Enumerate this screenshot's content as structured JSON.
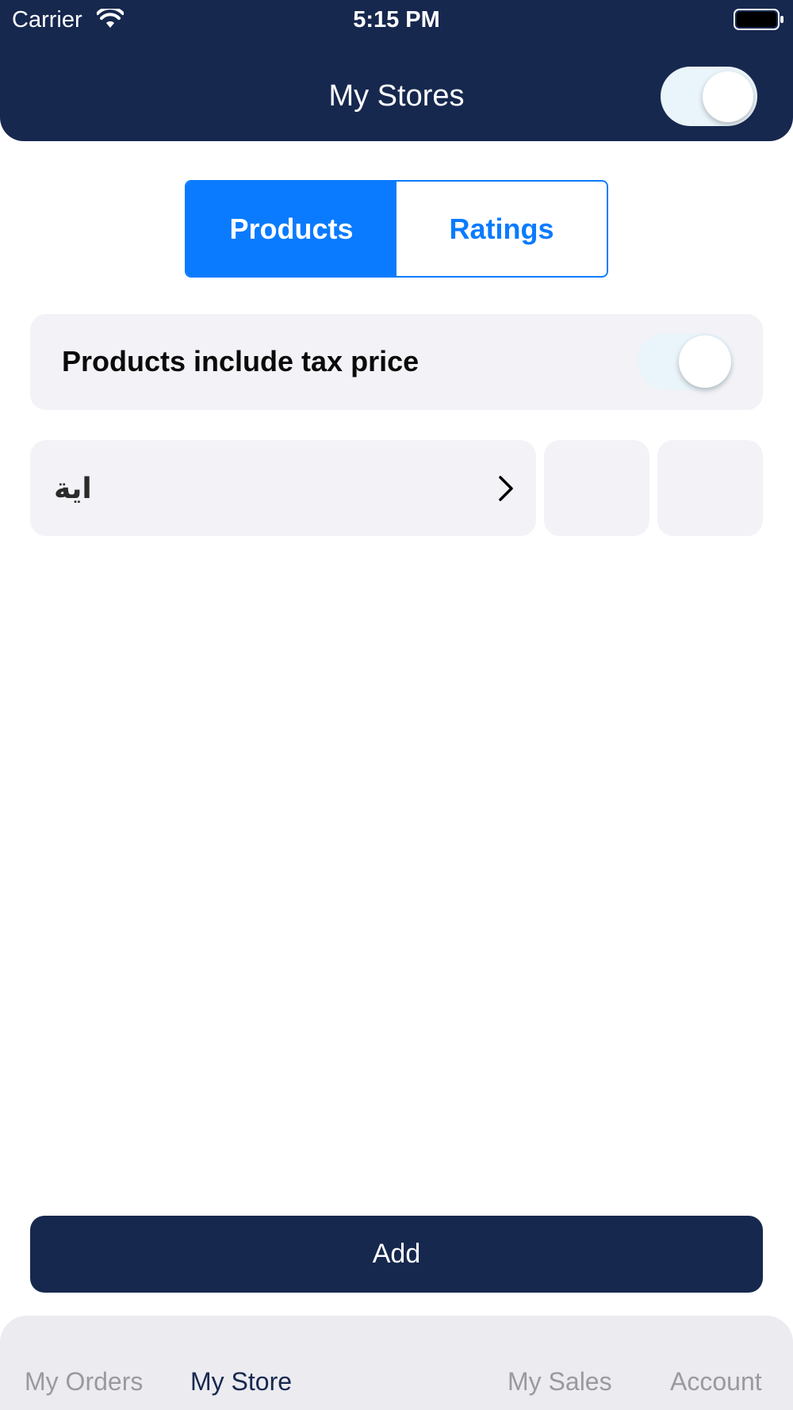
{
  "status_bar": {
    "carrier": "Carrier",
    "time": "5:15 PM",
    "icons": [
      "wifi-icon",
      "battery-icon"
    ]
  },
  "header": {
    "title": "My Stores",
    "store_toggle_on": true,
    "background_color": "#17284f"
  },
  "segmented_control": {
    "tabs": [
      {
        "label": "Products",
        "selected": true
      },
      {
        "label": "Ratings",
        "selected": false
      }
    ],
    "accent_color": "#0a7bff"
  },
  "tax_setting": {
    "label": "Products include tax price",
    "toggle_on": true
  },
  "category_row": {
    "label": "اية",
    "icon": "chevron-right-icon"
  },
  "actions": {
    "add_label": "Add"
  },
  "tab_bar": {
    "items": [
      {
        "label": "My Orders",
        "active": false
      },
      {
        "label": "My Store",
        "active": true
      },
      {
        "label": "My Sales",
        "active": false
      },
      {
        "label": "Account",
        "active": false
      }
    ],
    "active_color": "#17284f",
    "inactive_color": "#9a9a9e"
  }
}
